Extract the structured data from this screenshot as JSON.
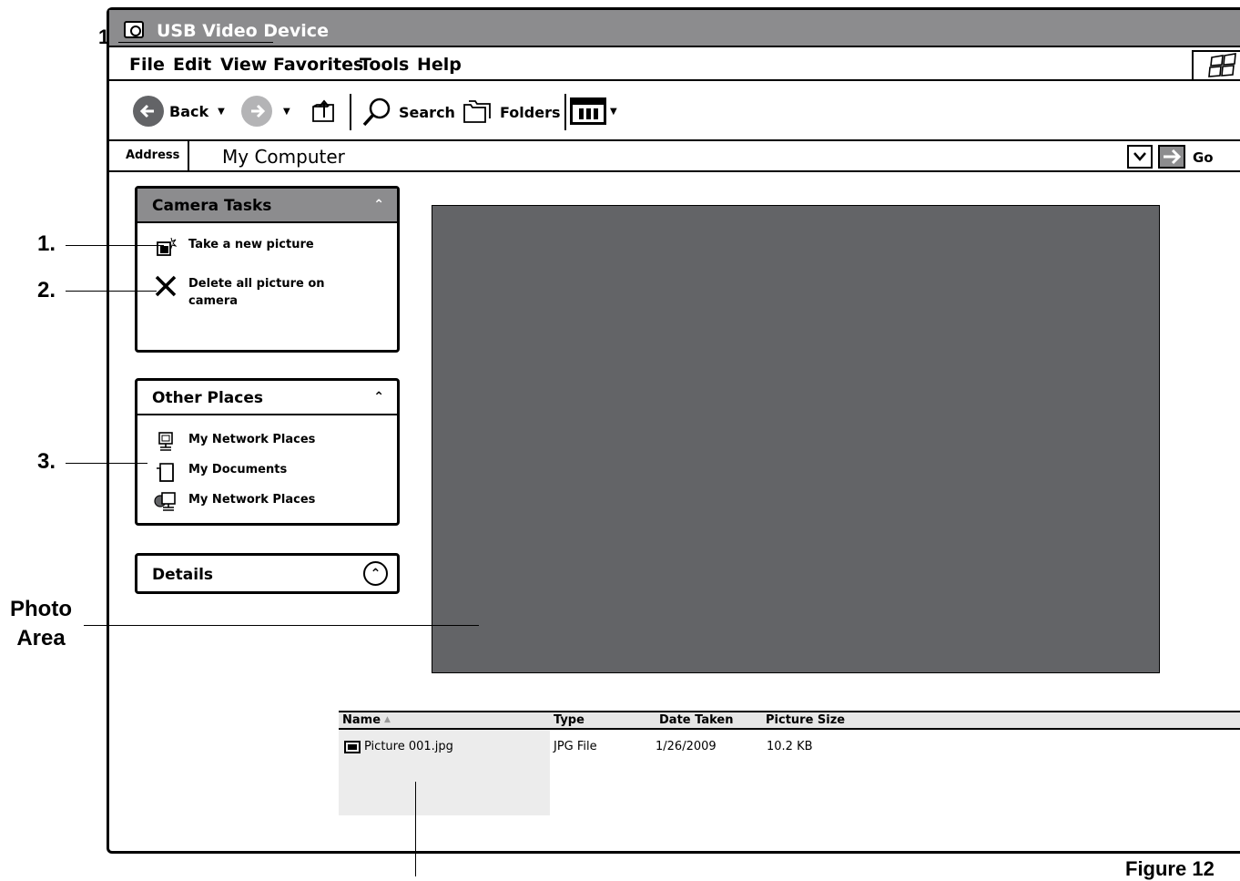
{
  "window": {
    "title": "USB Video Device"
  },
  "menu": [
    "File",
    "Edit",
    "View",
    "Favorites",
    "Tools",
    "Help"
  ],
  "toolbar": {
    "back_label": "Back",
    "search_label": "Search",
    "folders_label": "Folders"
  },
  "address": {
    "label": "Address",
    "value": "My Computer",
    "go_label": "Go"
  },
  "panels": {
    "camera_tasks": {
      "title": "Camera Tasks",
      "items": [
        "Take a new picture",
        "Delete all picture on camera"
      ]
    },
    "other_places": {
      "title": "Other Places",
      "items": [
        "My Network Places",
        "My Documents",
        "My Network Places"
      ]
    },
    "details": {
      "title": "Details"
    }
  },
  "file_list": {
    "columns": [
      "Name",
      "Type",
      "Date Taken",
      "Picture Size"
    ],
    "rows": [
      {
        "name": "Picture 001.jpg",
        "type": "JPG File",
        "date": "1/26/2009",
        "size": "10.2 KB"
      }
    ]
  },
  "callouts": {
    "c1": "1.",
    "c2": "2.",
    "c3": "3.",
    "photo_area_line1": "Photo",
    "photo_area_line2": "Area",
    "figure": "Figure 12"
  },
  "colors": {
    "titlebar": "#8c8c8e",
    "photo_area": "#636467"
  }
}
